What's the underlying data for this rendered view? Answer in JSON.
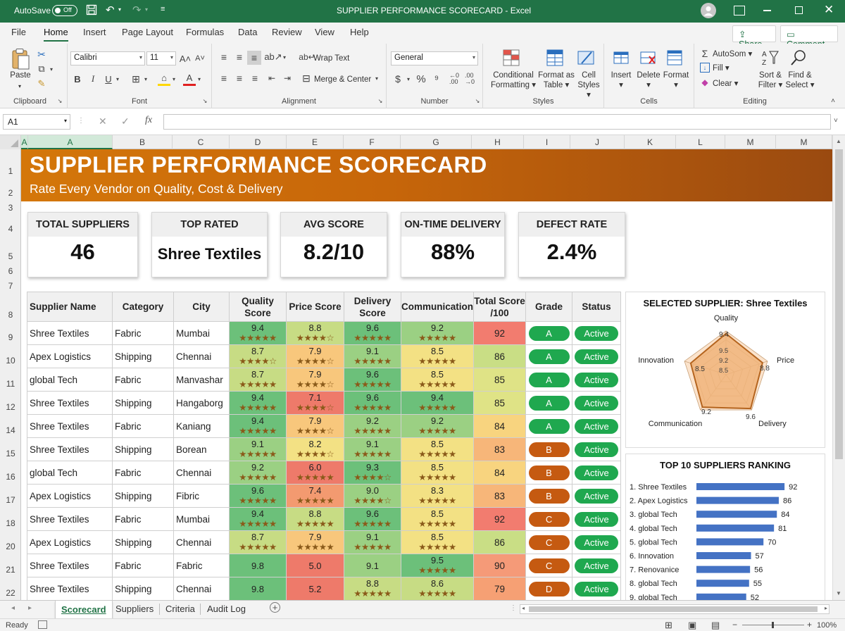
{
  "window": {
    "autosave_label": "AutoSave",
    "autosave_state": "Off",
    "title": "SUPPLIER PERFORMANCE SCORECARD  -  Excel"
  },
  "ribbon_tabs": [
    "File",
    "Home",
    "Insert",
    "Page Layout",
    "Formulas",
    "Data",
    "Review",
    "View",
    "Help"
  ],
  "share_label": "Share",
  "comment_label": "Comment",
  "ribbon": {
    "clipboard": {
      "paste": "Paste",
      "label": "Clipboard"
    },
    "font": {
      "name": "Calibri",
      "size": "11",
      "label": "Font"
    },
    "alignment": {
      "wrap": "Wrap Text",
      "merge": "Merge & Center",
      "label": "Alignment"
    },
    "number": {
      "format": "General",
      "label": "Number"
    },
    "styles": {
      "cond1": "Conditional",
      "cond2": "Formatting",
      "fmt1": "Format as",
      "fmt2": "Table",
      "cell1": "Cell",
      "cell2": "Styles",
      "label": "Styles"
    },
    "cells": {
      "insert": "Insert",
      "delete": "Delete",
      "format": "Format",
      "label": "Cells"
    },
    "editing": {
      "autosum": "AutoSom",
      "fill": "Fill",
      "clear": "Clear",
      "sort1": "Sort &",
      "sort2": "Filter",
      "find1": "Find &",
      "find2": "Select",
      "label": "Editing"
    }
  },
  "namebox": "A1",
  "fx": "fx",
  "columns": [
    "A",
    "A",
    "B",
    "C",
    "D",
    "E",
    "F",
    "G",
    "H",
    "I",
    "J",
    "K",
    "L",
    "M",
    "M"
  ],
  "rows": [
    "1",
    "2",
    "3",
    "4",
    "5",
    "6",
    "7",
    "8",
    "9",
    "10",
    "11",
    "12",
    "14",
    "15",
    "16",
    "17",
    "18",
    "20",
    "21",
    "22"
  ],
  "banner": {
    "title": "SUPPLIER PERFORMANCE SCORECARD",
    "subtitle": "Rate Every Vendor on Quality, Cost & Delivery"
  },
  "kpis": [
    {
      "label": "TOTAL SUPPLIERS",
      "value": "46"
    },
    {
      "label": "TOP RATED",
      "value": "Shree Textiles"
    },
    {
      "label": "AVG SCORE",
      "value": "8.2/10"
    },
    {
      "label": "ON-TIME DELIVERY",
      "value": "88%"
    },
    {
      "label": "DEFECT RATE",
      "value": "2.4%"
    }
  ],
  "table": {
    "headers": [
      "Supplier Name",
      "Category",
      "City",
      "Quality Score",
      "Price Score",
      "Delivery Score",
      "Communication",
      "Total Score /100",
      "Grade",
      "Status"
    ],
    "rows": [
      {
        "name": "Shree Textiles",
        "cat": "Fabric",
        "city": "Mumbai",
        "q": "9.4",
        "qs": "★★★★★",
        "p": "8.8",
        "ps": "★★★★☆",
        "d": "9.6",
        "ds": "★★★★★",
        "c": "9.2",
        "cs": "★★★★★",
        "t": "92",
        "g": "A",
        "s": "Active"
      },
      {
        "name": "Apex Logistics",
        "cat": "Shipping",
        "city": "Chennai",
        "q": "8.7",
        "qs": "★★★★☆",
        "p": "7.9",
        "ps": "★★★★☆",
        "d": "9.1",
        "ds": "★★★★★",
        "c": "8.5",
        "cs": "★★★★★",
        "t": "86",
        "g": "A",
        "s": "Active"
      },
      {
        "name": "global Tech",
        "cat": "Fabric",
        "city": "Manvashar",
        "q": "8.7",
        "qs": "★★★★★",
        "p": "7.9",
        "ps": "★★★★☆",
        "d": "9.6",
        "ds": "★★★★★",
        "c": "8.5",
        "cs": "★★★★★",
        "t": "85",
        "g": "A",
        "s": "Active"
      },
      {
        "name": "Shree Textiles",
        "cat": "Shipping",
        "city": "Hangaborg",
        "q": "9.4",
        "qs": "★★★★★",
        "p": "7.1",
        "ps": "★★★★☆",
        "d": "9.6",
        "ds": "★★★★★",
        "c": "9.4",
        "cs": "★★★★★",
        "t": "85",
        "g": "A",
        "s": "Active"
      },
      {
        "name": "Shree Textiles",
        "cat": "Fabric",
        "city": "Kaniang",
        "q": "9.4",
        "qs": "★★★★★",
        "p": "7.9",
        "ps": "★★★★☆",
        "d": "9.2",
        "ds": "★★★★★",
        "c": "9.2",
        "cs": "★★★★★",
        "t": "84",
        "g": "A",
        "s": "Active"
      },
      {
        "name": "Shree Textiles",
        "cat": "Shipping",
        "city": "Borean",
        "q": "9.1",
        "qs": "★★★★★",
        "p": "8.2",
        "ps": "★★★★☆",
        "d": "9.1",
        "ds": "★★★★★",
        "c": "8.5",
        "cs": "★★★★★",
        "t": "83",
        "g": "B",
        "s": "Active"
      },
      {
        "name": "global Tech",
        "cat": "Fabric",
        "city": "Chennai",
        "q": "9.2",
        "qs": "★★★★★",
        "p": "6.0",
        "ps": "★★★★★",
        "d": "9.3",
        "ds": "★★★★☆",
        "c": "8.5",
        "cs": "★★★★★",
        "t": "84",
        "g": "B",
        "s": "Active"
      },
      {
        "name": "Apex Logistics",
        "cat": "Shipping",
        "city": "Fibric",
        "q": "9.6",
        "qs": "★★★★★",
        "p": "7.4",
        "ps": "★★★★★",
        "d": "9.0",
        "ds": "★★★★☆",
        "c": "8.3",
        "cs": "★★★★★",
        "t": "83",
        "g": "B",
        "s": "Active"
      },
      {
        "name": "Shree Textiles",
        "cat": "Fabric",
        "city": "Mumbai",
        "q": "9.4",
        "qs": "★★★★★",
        "p": "8.8",
        "ps": "★★★★★",
        "d": "9.6",
        "ds": "★★★★★",
        "c": "8.5",
        "cs": "★★★★★",
        "t": "92",
        "g": "C",
        "s": "Active"
      },
      {
        "name": "Apex Logistics",
        "cat": "Shipping",
        "city": "Chennai",
        "q": "8.7",
        "qs": "★★★★★",
        "p": "7.9",
        "ps": "★★★★★",
        "d": "9.1",
        "ds": "★★★★★",
        "c": "8.5",
        "cs": "★★★★★",
        "t": "86",
        "g": "C",
        "s": "Active"
      },
      {
        "name": "Shree Textiles",
        "cat": "Fabric",
        "city": "Fabric",
        "q": "9.8",
        "qs": "",
        "p": "5.0",
        "ps": "",
        "d": "9.1",
        "ds": "",
        "c": "9.5",
        "cs": "★★★★★",
        "t": "90",
        "g": "C",
        "s": "Active"
      },
      {
        "name": "Shree Textiles",
        "cat": "Shipping",
        "city": "Chennai",
        "q": "9.8",
        "qs": "",
        "p": "5.2",
        "ps": "",
        "d": "8.8",
        "ds": "★★★★★",
        "c": "8.6",
        "cs": "★★★★★",
        "t": "79",
        "g": "D",
        "s": "Active"
      }
    ]
  },
  "colors": {
    "excel_green": "#217346",
    "grade_A": "#1fa84f",
    "grade_B": "#c55a11",
    "grade_C": "#c55a11",
    "grade_D": "#c55a11",
    "status_active": "#1fa84f",
    "bar": "#4472c4",
    "radar_fill": "#f0b47a"
  },
  "radar": {
    "title": "SELECTED SUPPLIER: Shree Textiles",
    "axes": [
      "Quality",
      "Price",
      "Delivery",
      "Communication",
      "Innovation"
    ],
    "values": [
      9.4,
      8.8,
      9.6,
      9.2,
      8.5
    ],
    "ring_labels": [
      "9.5",
      "9.2",
      "8.5"
    ],
    "max": 10
  },
  "chart_data": {
    "type": "bar",
    "title": "TOP 10 SUPPLIERS RANKING",
    "categories": [
      "1. Shree Textiles",
      "2. Apex Logistics",
      "3. global Tech",
      "4. global Tech",
      "5. global Tech",
      "6.  Innovation",
      "7. Renovanice",
      "8. global Tech",
      "9. global Tech"
    ],
    "values": [
      92,
      86,
      84,
      81,
      70,
      57,
      56,
      55,
      52
    ],
    "xlim": [
      0,
      100
    ],
    "orientation": "horizontal"
  },
  "sheet_tabs": [
    "Scorecard",
    "Suppliers",
    "Criteria",
    "Audit Log"
  ],
  "status": {
    "ready": "Ready",
    "zoom": "100%"
  }
}
